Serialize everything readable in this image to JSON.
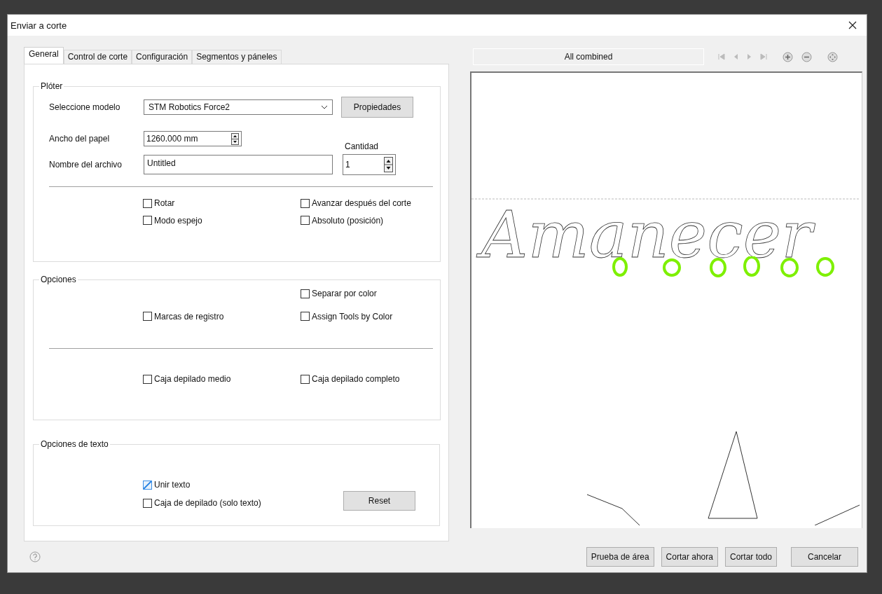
{
  "dialog": {
    "title": "Enviar a corte"
  },
  "tabs": [
    {
      "label": "General",
      "selected": true
    },
    {
      "label": "Control de corte",
      "selected": false
    },
    {
      "label": "Configuración",
      "selected": false
    },
    {
      "label": "Segmentos y páneles",
      "selected": false
    }
  ],
  "plotter": {
    "legend": "Plóter",
    "model_label": "Seleccione modelo",
    "model_value": "STM Robotics Force2",
    "properties_button": "Propiedades",
    "paper_width_label": "Ancho del papel",
    "paper_width_value": "1260.000 mm",
    "quantity_label": "Cantidad",
    "file_name_label": "Nombre del archivo",
    "file_name_value": "Untitled",
    "quantity_value": "1",
    "rows": [
      {
        "left": {
          "label": "Rotar",
          "checked": false
        },
        "right": {
          "label": "Avanzar después del corte",
          "checked": false
        }
      },
      {
        "left": {
          "label": "Modo espejo",
          "checked": false
        },
        "right": {
          "label": "Absoluto (posición)",
          "checked": false
        }
      }
    ]
  },
  "options": {
    "legend": "Opciones",
    "rows": [
      {
        "right": {
          "label": "Separar por color",
          "checked": false
        }
      },
      {
        "left": {
          "label": "Marcas de registro",
          "checked": false
        },
        "right": {
          "label": "Assign Tools by Color",
          "checked": false
        }
      }
    ],
    "rows_below": [
      {
        "left": {
          "label": "Caja depilado medio",
          "checked": false
        },
        "right": {
          "label": "Caja depilado completo",
          "checked": false
        }
      }
    ]
  },
  "text_options": {
    "legend": "Opciones de texto",
    "checkboxes": [
      {
        "label": "Unir texto",
        "checked": true
      },
      {
        "label": "Caja de depilado (solo texto)",
        "checked": false
      }
    ],
    "reset_button": "Reset"
  },
  "preview": {
    "view": "All combined",
    "design_text": "Amanecer"
  },
  "buttons": [
    "Prueba de área",
    "Cortar ahora",
    "Cortar todo",
    "Cancelar"
  ]
}
